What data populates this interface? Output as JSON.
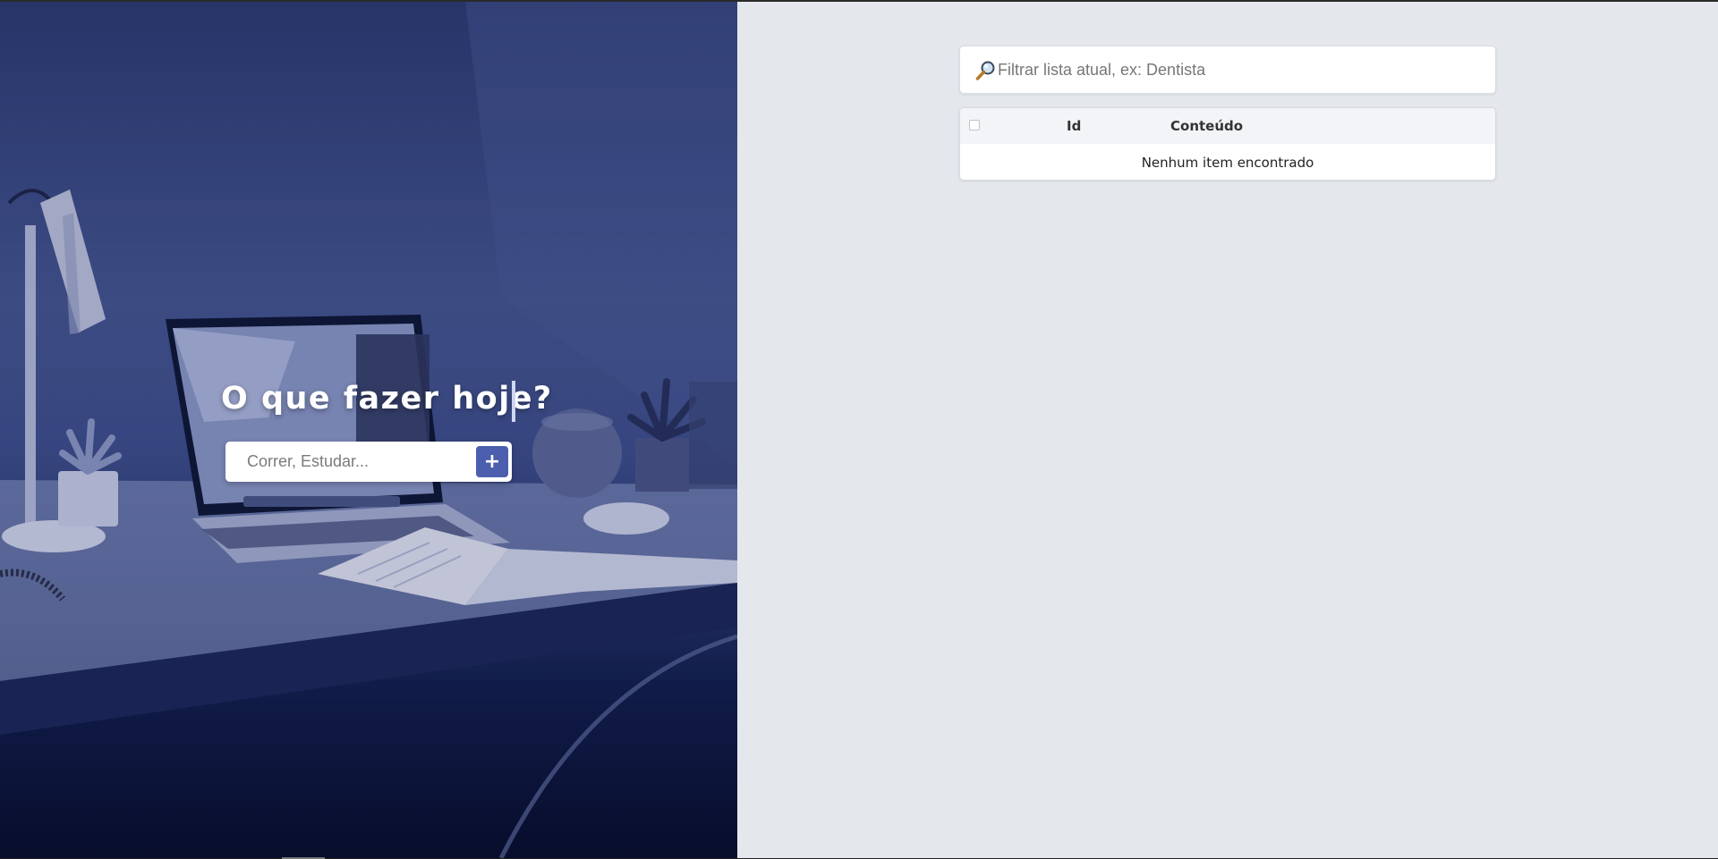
{
  "hero": {
    "title": "O que fazer hoje?",
    "task_input_placeholder": "Correr, Estudar...",
    "add_button_label": "+"
  },
  "filter": {
    "placeholder": "Filtrar lista atual, ex: Dentista",
    "icon": "magnifier-icon"
  },
  "table": {
    "columns": [
      "Id",
      "Conteúdo"
    ],
    "empty_message": "Nenhum item encontrado",
    "rows": []
  },
  "colors": {
    "accent": "#4b5fae",
    "main_background": "#e4e7ec",
    "hero_tint": "#2b3a6e"
  }
}
